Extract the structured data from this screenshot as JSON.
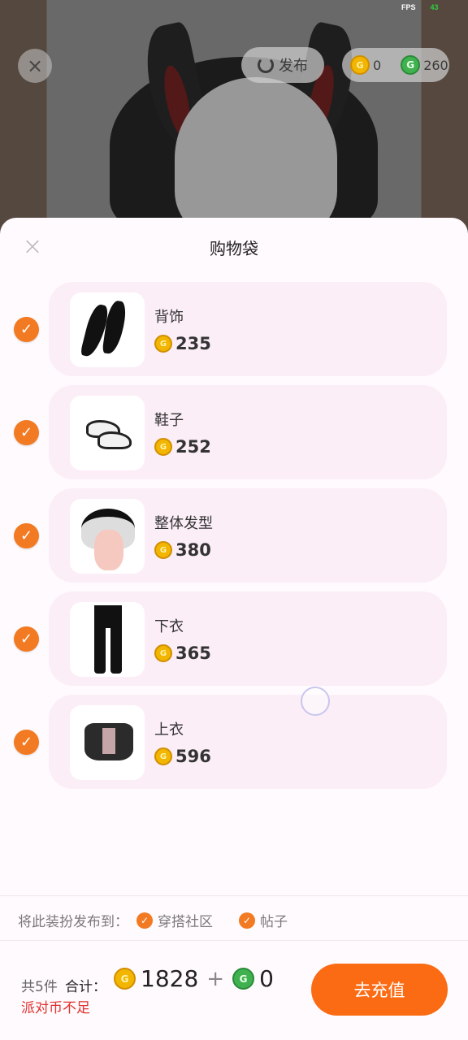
{
  "status": {
    "fps_label": "FPS",
    "fps_value": "43"
  },
  "top_bar": {
    "close_label": "×",
    "publish_label": "发布",
    "gold_coins": "0",
    "green_coins": "260"
  },
  "panel": {
    "close_label": "×",
    "title": "购物袋"
  },
  "items": [
    {
      "name": "背饰",
      "price": "235",
      "checked": true
    },
    {
      "name": "鞋子",
      "price": "252",
      "checked": true
    },
    {
      "name": "整体发型",
      "price": "380",
      "checked": true
    },
    {
      "name": "下衣",
      "price": "365",
      "checked": true
    },
    {
      "name": "上衣",
      "price": "596",
      "checked": true
    }
  ],
  "publish_to": {
    "label": "将此装扮发布到：",
    "options": [
      "穿搭社区",
      "帖子"
    ]
  },
  "footer": {
    "count_label": "共5件",
    "total_label": "合计：",
    "gold_total": "1828",
    "plus": "+",
    "green_total": "0",
    "warning": "派对币不足",
    "recharge_label": "去充值"
  },
  "colors": {
    "accent": "#fb6b14",
    "check": "#f27a22",
    "warning": "#e0322e",
    "item_bg": "#fbeef7"
  },
  "icons": {
    "gold_coin": "gold-coin-icon",
    "green_coin": "green-coin-icon",
    "check": "check-icon",
    "close": "close-icon",
    "publish": "refresh-publish-icon"
  }
}
